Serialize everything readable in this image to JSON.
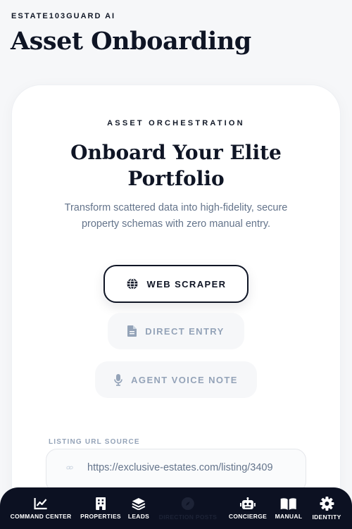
{
  "app": {
    "brand": "ESTATE103GUARD AI",
    "page_title": "Asset Onboarding"
  },
  "card": {
    "eyebrow": "ASSET ORCHESTRATION",
    "headline": "Onboard Your Elite Portfolio",
    "subtitle": "Transform scattered data into high-fidelity, secure property schemas with zero manual entry.",
    "methods": [
      {
        "label": "WEB SCRAPER",
        "icon": "globe-icon",
        "active": true
      },
      {
        "label": "DIRECT ENTRY",
        "icon": "document-icon",
        "active": false
      },
      {
        "label": "AGENT VOICE NOTE",
        "icon": "microphone-icon",
        "active": false
      }
    ],
    "url_field": {
      "label": "LISTING URL SOURCE",
      "value": "https://exclusive-estates.com/listing/3409",
      "icon": "link-icon"
    }
  },
  "nav": {
    "items": [
      {
        "label": "COMMAND CENTER",
        "icon": "chart-line-icon"
      },
      {
        "label": "PROPERTIES",
        "icon": "building-icon"
      },
      {
        "label": "LEADS",
        "icon": "layers-icon"
      },
      {
        "label": "DIRECTION POSTS",
        "icon": "compass-icon"
      },
      {
        "label": "CONCIERGE",
        "icon": "robot-icon"
      },
      {
        "label": "MANUAL",
        "icon": "book-icon"
      },
      {
        "label": "IDENTITY",
        "icon": "gear-icon"
      }
    ]
  },
  "colors": {
    "primary": "#0f1525",
    "muted": "#94a3b8",
    "nav_bg": "#0c1122",
    "page_bg": "#f6f7f9"
  }
}
